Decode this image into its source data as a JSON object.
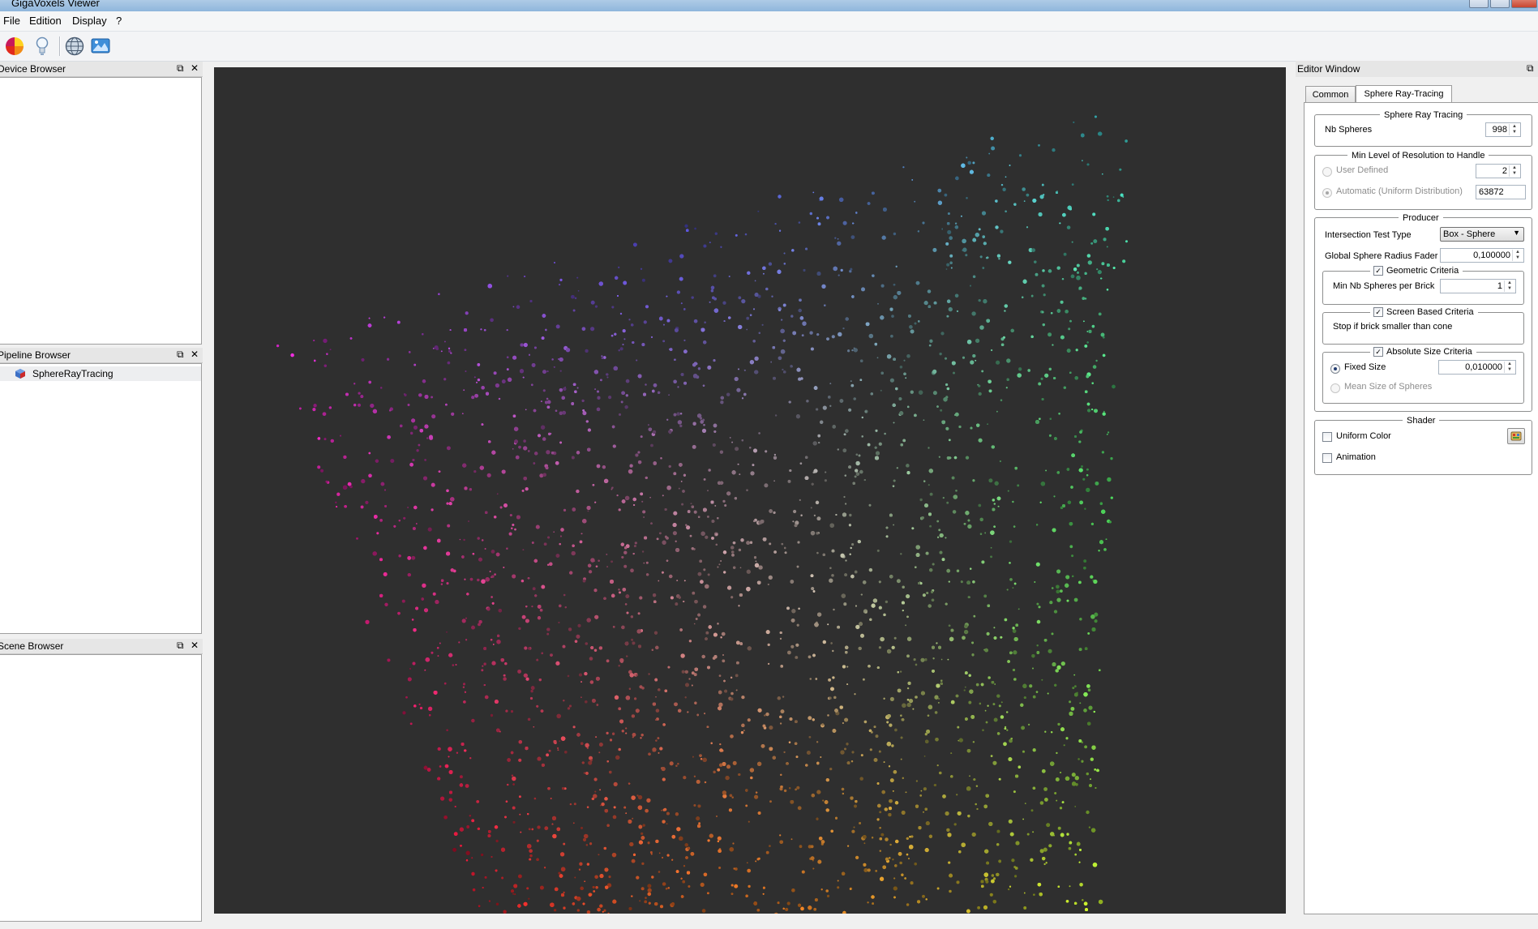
{
  "window": {
    "title": "GigaVoxels Viewer"
  },
  "menu": {
    "file": "File",
    "edition": "Edition",
    "display": "Display",
    "help": "?"
  },
  "toolbar": {
    "icons": [
      "color-pie-icon",
      "light-bulb-icon",
      "globe-icon",
      "image-icon"
    ]
  },
  "docks": {
    "device_browser": {
      "title": "Device Browser"
    },
    "pipeline_browser": {
      "title": "Pipeline Browser",
      "items": [
        "SphereRayTracing"
      ]
    },
    "scene_browser": {
      "title": "Scene Browser"
    }
  },
  "viewport": {
    "background": "#2f2f2f",
    "point_count": 9000
  },
  "editor": {
    "title": "Editor Window",
    "tabs": [
      "Common",
      "Sphere Ray-Tracing"
    ],
    "active_tab": "Sphere Ray-Tracing",
    "sphere_ray_tracing": {
      "title": "Sphere Ray Tracing",
      "nb_spheres_label": "Nb Spheres",
      "nb_spheres": "998"
    },
    "min_level": {
      "title": "Min Level of Resolution to Handle",
      "user_defined_label": "User Defined",
      "user_defined_value": "2",
      "automatic_label": "Automatic (Uniform Distribution)",
      "automatic_value": "63872"
    },
    "producer": {
      "title": "Producer",
      "intersection_label": "Intersection Test Type",
      "intersection_value": "Box - Sphere",
      "radius_fader_label": "Global Sphere Radius Fader",
      "radius_fader_value": "0,100000",
      "geometric_title": "Geometric Criteria",
      "min_spheres_label": "Min Nb Spheres per Brick",
      "min_spheres_value": "1",
      "screen_title": "Screen Based Criteria",
      "screen_text": "Stop if brick smaller than cone",
      "absolute_title": "Absolute Size Criteria",
      "fixed_size_label": "Fixed Size",
      "fixed_size_value": "0,010000",
      "mean_size_label": "Mean Size of Spheres"
    },
    "shader": {
      "title": "Shader",
      "uniform_color_label": "Uniform Color",
      "animation_label": "Animation"
    }
  }
}
